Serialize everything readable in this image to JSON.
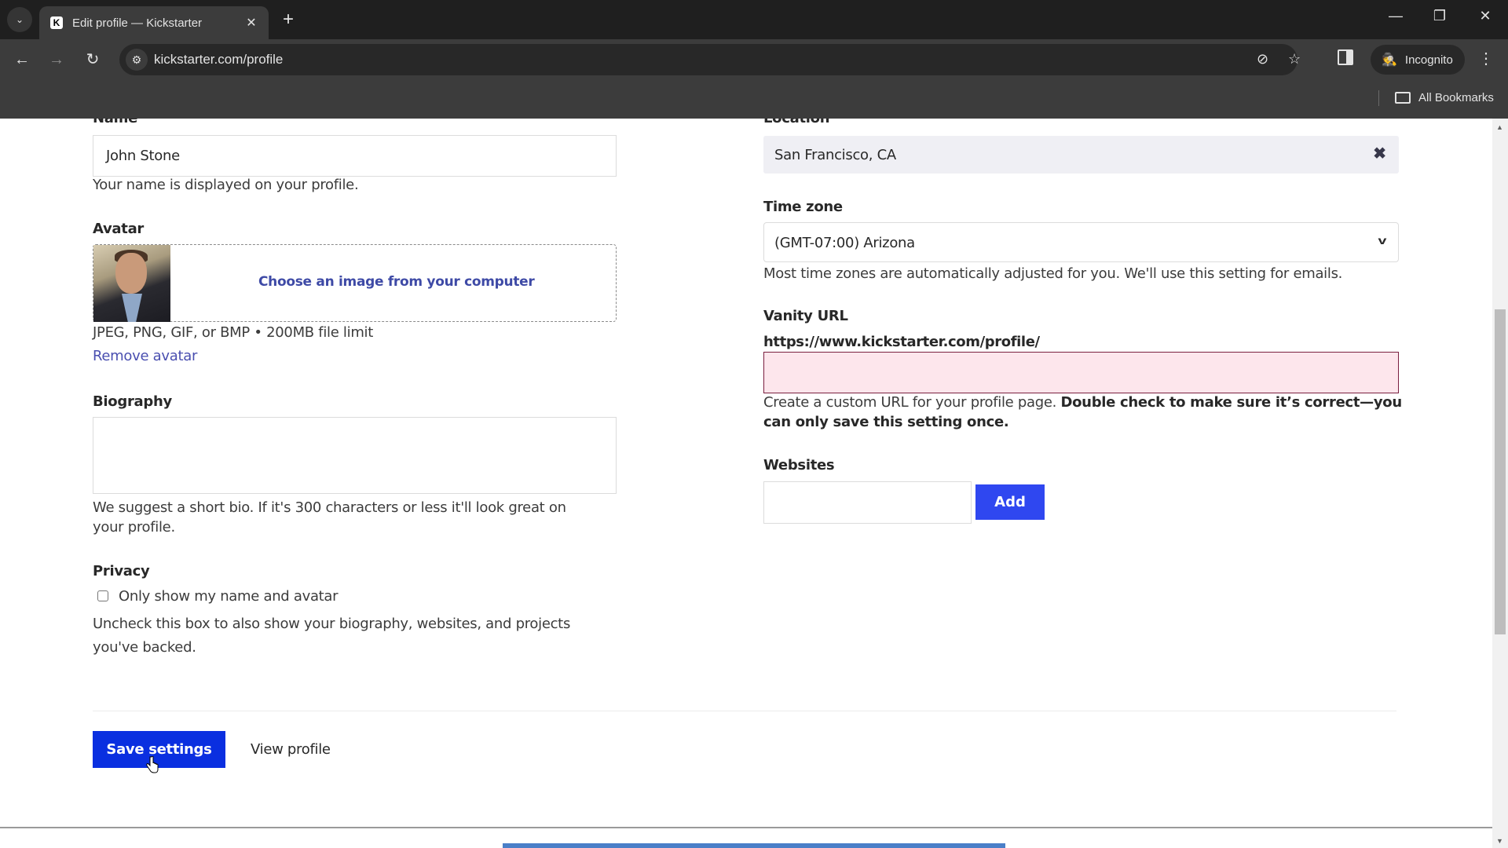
{
  "browser": {
    "tab_title": "Edit profile — Kickstarter",
    "favicon_letter": "K",
    "url": "kickstarter.com/profile",
    "incognito_label": "Incognito",
    "bookmarks_label": "All Bookmarks",
    "icons": {
      "tab_list": "⌄",
      "tab_close": "✕",
      "new_tab": "+",
      "minimize": "—",
      "restore": "❐",
      "close": "✕",
      "back": "←",
      "forward": "→",
      "reload": "↻",
      "site_info": "⚙",
      "eye_off": "⊘",
      "star": "☆",
      "incognito": "🕵",
      "menu": "⋮"
    }
  },
  "form": {
    "name": {
      "label": "Name",
      "value": "John Stone",
      "help": "Your name is displayed on your profile."
    },
    "avatar": {
      "label": "Avatar",
      "choose_label": "Choose an image from your computer",
      "help": "JPEG, PNG, GIF, or BMP • 200MB file limit",
      "remove_label": "Remove avatar"
    },
    "biography": {
      "label": "Biography",
      "value": "",
      "help": "We suggest a short bio. If it's 300 characters or less it'll look great on your profile."
    },
    "privacy": {
      "label": "Privacy",
      "checkbox_label": "Only show my name and avatar",
      "checked": false,
      "help": "Uncheck this box to also show your biography, websites, and projects you've backed."
    },
    "location": {
      "label": "Location",
      "value": "San Francisco, CA",
      "clear_icon": "✖"
    },
    "timezone": {
      "label": "Time zone",
      "selected": "(GMT-07:00) Arizona",
      "help": "Most time zones are automatically adjusted for you. We'll use this setting for emails."
    },
    "vanity_url": {
      "label": "Vanity URL",
      "prefix": "https://www.kickstarter.com/profile/",
      "value": "",
      "help_regular": "Create a custom URL for your profile page. ",
      "help_bold": "Double check to make sure it’s correct—you can only save this setting once."
    },
    "websites": {
      "label": "Websites",
      "value": "",
      "add_label": "Add"
    },
    "actions": {
      "save_label": "Save settings",
      "view_profile_label": "View profile"
    }
  },
  "colors": {
    "primary_button": "#0a2fe0",
    "add_button": "#2f47f0",
    "link": "#4a4fb0",
    "error_field_bg": "#fde6ec",
    "error_field_border": "#7a1f3f"
  }
}
